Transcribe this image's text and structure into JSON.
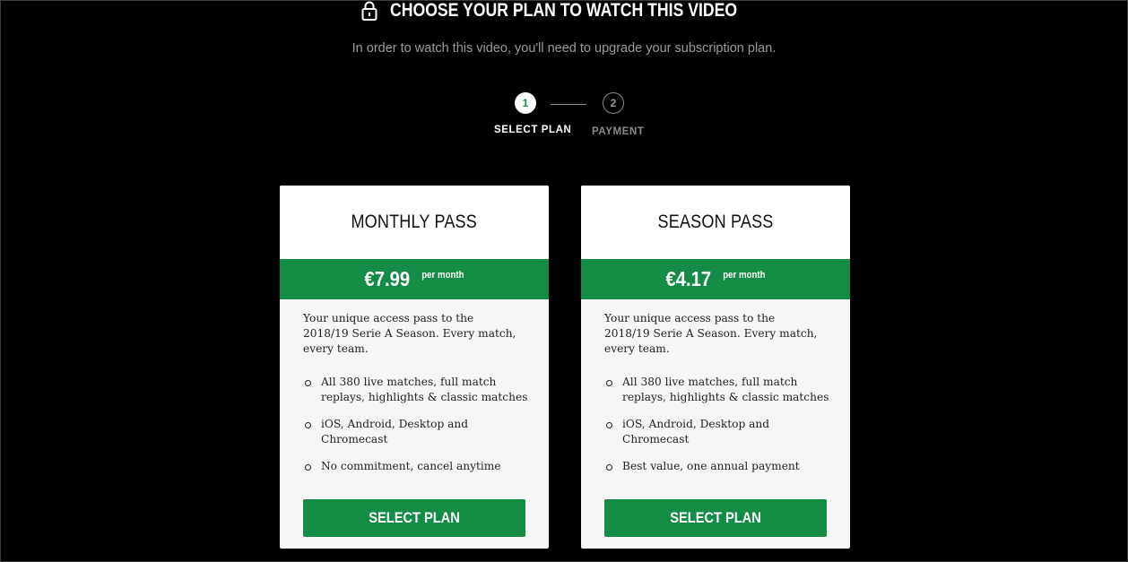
{
  "header": {
    "title": "CHOOSE YOUR PLAN TO WATCH THIS VIDEO",
    "subtitle": "In order to watch this video, you'll need to upgrade your subscription plan.",
    "icon": "lock-icon"
  },
  "stepper": {
    "steps": [
      {
        "number": "1",
        "label": "SELECT PLAN",
        "active": true
      },
      {
        "number": "2",
        "label": "PAYMENT",
        "active": false
      }
    ]
  },
  "plans": [
    {
      "name": "MONTHLY PASS",
      "price": "€7.99",
      "period": "per month",
      "description": "Your unique access pass to the 2018/19 Serie A Season. Every match, every team.",
      "features": [
        "All 380 live matches, full match replays, highlights & classic matches",
        "iOS, Android, Desktop and Chromecast",
        "No commitment, cancel anytime"
      ],
      "button": "SELECT PLAN"
    },
    {
      "name": "SEASON PASS",
      "price": "€4.17",
      "period": "per month",
      "description": "Your unique access pass to the 2018/19 Serie A Season. Every match, every team.",
      "features": [
        "All 380 live matches, full match replays, highlights & classic matches",
        "iOS, Android, Desktop and Chromecast",
        "Best value, one annual payment"
      ],
      "button": "SELECT PLAN"
    }
  ],
  "colors": {
    "accent": "#148c46",
    "background": "#000000",
    "card": "#f6f6f6"
  }
}
